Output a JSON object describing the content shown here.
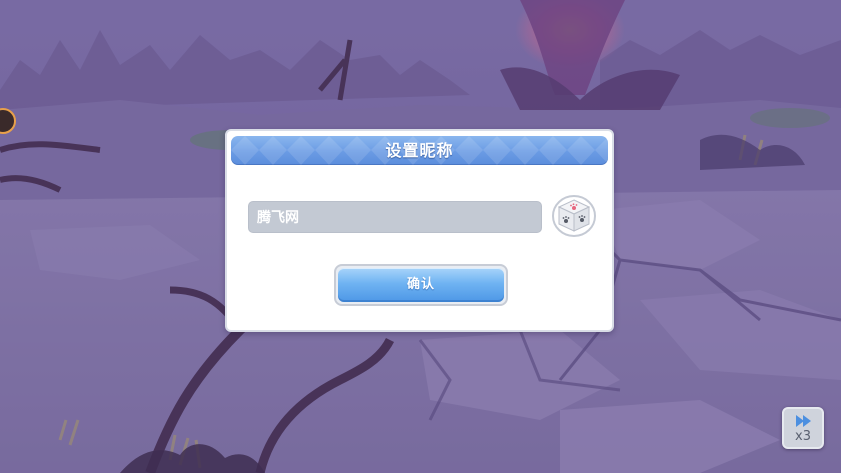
{
  "dialog": {
    "title": "设置昵称",
    "nickname_value": "腾飞网",
    "confirm_label": "确认",
    "dice_icon": "dice-icon"
  },
  "speed": {
    "icon": "fast-forward-icon",
    "label": "x3"
  },
  "colors": {
    "header_blue": "#6a9be4",
    "confirm_blue": "#6fb3f2",
    "input_gray": "#c3c9d3",
    "dialog_white": "#ffffff",
    "background_purple": "#6f5f8e"
  }
}
